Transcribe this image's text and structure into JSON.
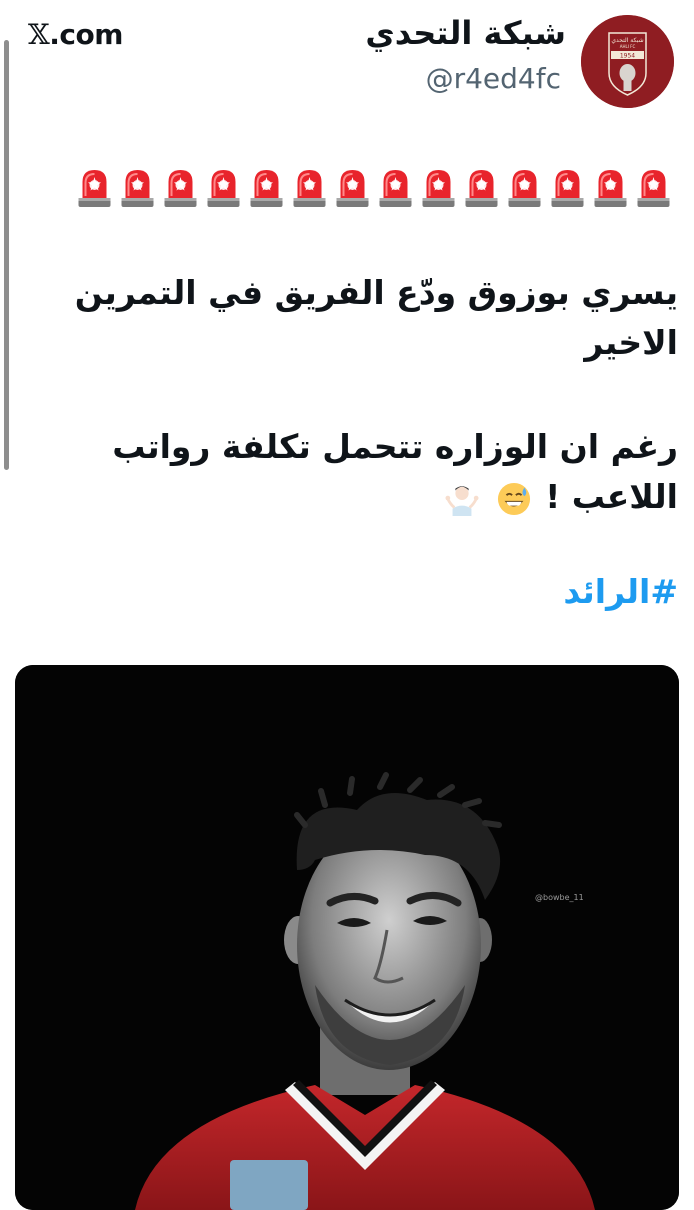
{
  "brand": {
    "label": "X.com",
    "x_glyph": "𝕏",
    "rest": ".com"
  },
  "author": {
    "display_name": "شبكة التحدي",
    "handle": "@r4ed4fc",
    "avatar_logo_top_text": "شبكة التحدي",
    "avatar_logo_sub_text": "AHLI FC",
    "avatar_logo_year": "1954"
  },
  "tweet": {
    "siren_count": 14,
    "line1": "يسري بوزوق ودّع الفريق في التمرين الاخير",
    "line2": "رغم ان الوزاره تتحمل تكلفة رواتب اللاعب !",
    "hashtag": "#الرائد",
    "emojis": [
      "sweat-smile-emoji",
      "person-shrugging-emoji"
    ]
  },
  "media": {
    "watermark": "@bowbe_11",
    "description_icon": "player-photo"
  },
  "colors": {
    "link": "#1d9bf0",
    "avatar_bg": "#8f1d22",
    "siren_red": "#e8242c",
    "handle": "#536471"
  }
}
